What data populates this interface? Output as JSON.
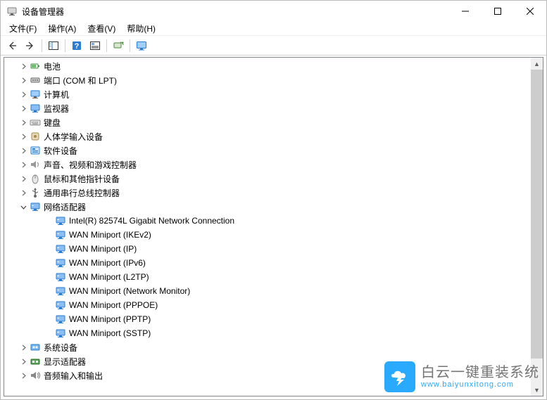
{
  "window": {
    "title": "设备管理器"
  },
  "menu": {
    "file": "文件(F)",
    "action": "操作(A)",
    "view": "查看(V)",
    "help": "帮助(H)"
  },
  "tree": {
    "items": [
      {
        "icon": "battery",
        "label": "电池",
        "expandable": true,
        "expanded": false
      },
      {
        "icon": "port",
        "label": "端口 (COM 和 LPT)",
        "expandable": true,
        "expanded": false
      },
      {
        "icon": "computer",
        "label": "计算机",
        "expandable": true,
        "expanded": false
      },
      {
        "icon": "monitor",
        "label": "监视器",
        "expandable": true,
        "expanded": false
      },
      {
        "icon": "keyboard",
        "label": "键盘",
        "expandable": true,
        "expanded": false
      },
      {
        "icon": "hid",
        "label": "人体学输入设备",
        "expandable": true,
        "expanded": false
      },
      {
        "icon": "software",
        "label": "软件设备",
        "expandable": true,
        "expanded": false
      },
      {
        "icon": "sound",
        "label": "声音、视频和游戏控制器",
        "expandable": true,
        "expanded": false
      },
      {
        "icon": "mouse",
        "label": "鼠标和其他指针设备",
        "expandable": true,
        "expanded": false
      },
      {
        "icon": "usb",
        "label": "通用串行总线控制器",
        "expandable": true,
        "expanded": false
      },
      {
        "icon": "network",
        "label": "网络适配器",
        "expandable": true,
        "expanded": true,
        "children": [
          {
            "icon": "nic",
            "label": "Intel(R) 82574L Gigabit Network Connection"
          },
          {
            "icon": "nic",
            "label": "WAN Miniport (IKEv2)"
          },
          {
            "icon": "nic",
            "label": "WAN Miniport (IP)"
          },
          {
            "icon": "nic",
            "label": "WAN Miniport (IPv6)"
          },
          {
            "icon": "nic",
            "label": "WAN Miniport (L2TP)"
          },
          {
            "icon": "nic",
            "label": "WAN Miniport (Network Monitor)"
          },
          {
            "icon": "nic",
            "label": "WAN Miniport (PPPOE)"
          },
          {
            "icon": "nic",
            "label": "WAN Miniport (PPTP)"
          },
          {
            "icon": "nic",
            "label": "WAN Miniport (SSTP)"
          }
        ]
      },
      {
        "icon": "system",
        "label": "系统设备",
        "expandable": true,
        "expanded": false
      },
      {
        "icon": "display",
        "label": "显示适配器",
        "expandable": true,
        "expanded": false
      },
      {
        "icon": "audio",
        "label": "音频输入和输出",
        "expandable": true,
        "expanded": false
      }
    ]
  },
  "watermark": {
    "main": "白云一键重装系统",
    "sub": "www.baiyunxitong.com"
  }
}
